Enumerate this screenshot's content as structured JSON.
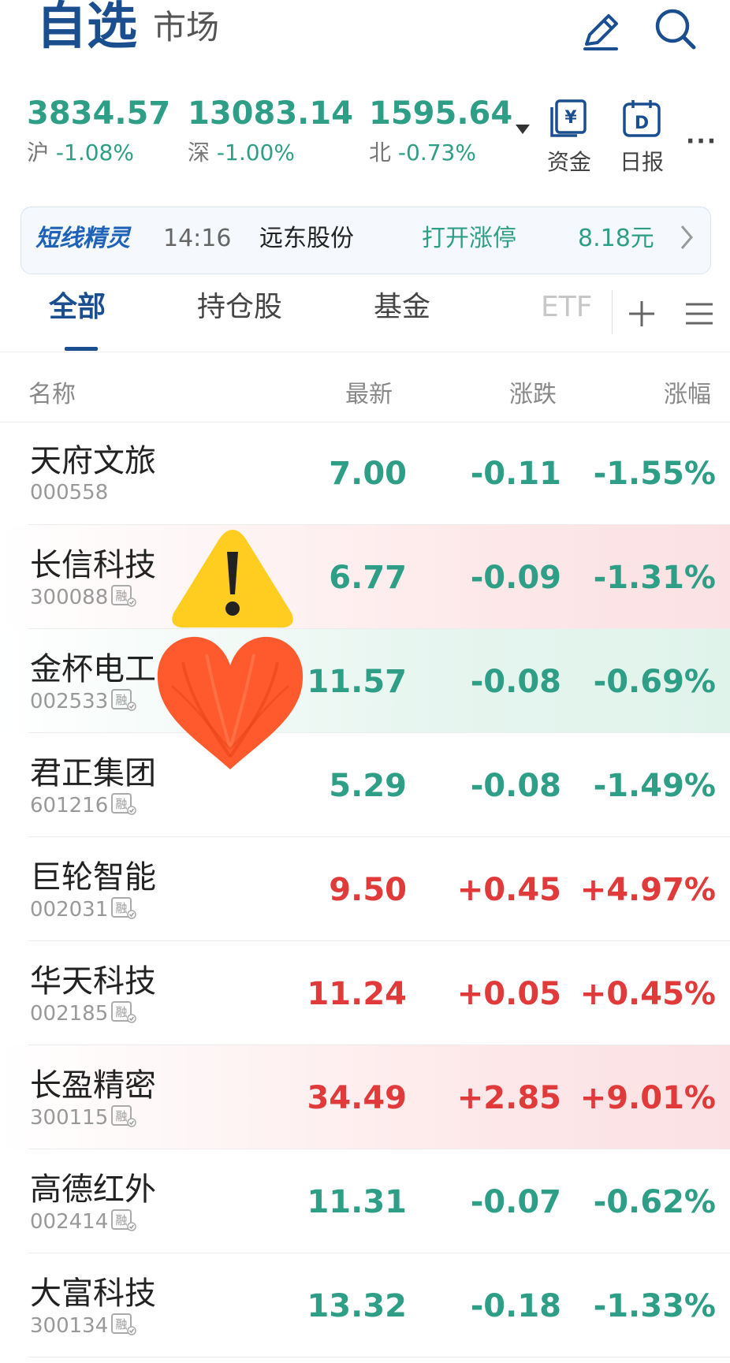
{
  "header": {
    "title": "自选",
    "subtitle": "市场",
    "icons": [
      "edit-icon",
      "search-icon"
    ]
  },
  "indexes": [
    {
      "value": "3834.57",
      "name": "沪",
      "change": "-1.08%"
    },
    {
      "value": "13083.14",
      "name": "深",
      "change": "-1.00%"
    },
    {
      "value": "1595.64",
      "name": "北",
      "change": "-0.73%"
    }
  ],
  "tools": {
    "funds_label": "资金",
    "daily_label": "日报",
    "funds_glyph": "¥",
    "daily_glyph": "D",
    "more_label": "···"
  },
  "banner": {
    "brand": "短线精灵",
    "time": "14:16",
    "stock": "远东股份",
    "event": "打开涨停",
    "price": "8.18元"
  },
  "tabs": [
    {
      "label": "全部",
      "active": true
    },
    {
      "label": "持仓股",
      "active": false
    },
    {
      "label": "基金",
      "active": false
    },
    {
      "label": "ETF",
      "active": false
    }
  ],
  "columns": {
    "name": "名称",
    "latest": "最新",
    "change": "涨跌",
    "percent": "涨幅"
  },
  "rong_label": "融",
  "rows": [
    {
      "name": "天府文旅",
      "code": "000558",
      "price": "7.00",
      "change": "-0.11",
      "pct": "-1.55%",
      "margin": false
    },
    {
      "name": "长信科技",
      "code": "300088",
      "price": "6.77",
      "change": "-0.09",
      "pct": "-1.31%",
      "margin": true
    },
    {
      "name": "金杯电工",
      "code": "002533",
      "price": "11.57",
      "change": "-0.08",
      "pct": "-0.69%",
      "margin": true
    },
    {
      "name": "君正集团",
      "code": "601216",
      "price": "5.29",
      "change": "-0.08",
      "pct": "-1.49%",
      "margin": true
    },
    {
      "name": "巨轮智能",
      "code": "002031",
      "price": "9.50",
      "change": "+0.45",
      "pct": "+4.97%",
      "margin": true
    },
    {
      "name": "华天科技",
      "code": "002185",
      "price": "11.24",
      "change": "+0.05",
      "pct": "+0.45%",
      "margin": true
    },
    {
      "name": "长盈精密",
      "code": "300115",
      "price": "34.49",
      "change": "+2.85",
      "pct": "+9.01%",
      "margin": true
    },
    {
      "name": "高德红外",
      "code": "002414",
      "price": "11.31",
      "change": "-0.07",
      "pct": "-0.62%",
      "margin": true
    },
    {
      "name": "大富科技",
      "code": "300134",
      "price": "13.32",
      "change": "-0.18",
      "pct": "-1.33%",
      "margin": true
    }
  ],
  "colors": {
    "brand": "#1a4e8f",
    "down": "#2e9f86",
    "up": "#e03a3a"
  },
  "stickers": [
    "warning-sticker",
    "heart-sticker"
  ]
}
